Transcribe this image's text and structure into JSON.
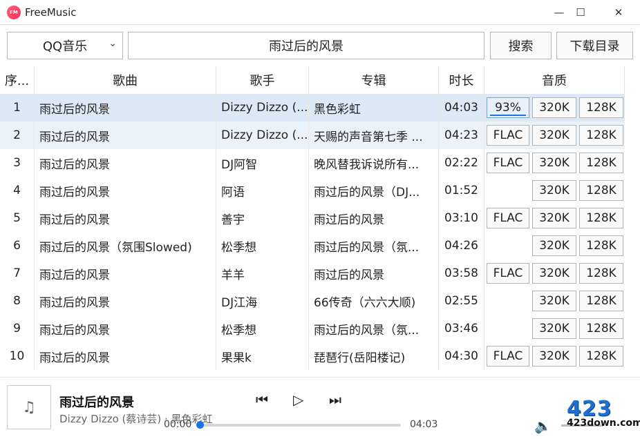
{
  "app": {
    "title": "FreeMusic",
    "logo_text": "FM"
  },
  "window": {
    "minimize": "—",
    "maximize": "☐",
    "close": "✕"
  },
  "search": {
    "source": "QQ音乐",
    "query": "雨过后的风景",
    "search_label": "搜索",
    "download_dir_label": "下载目录"
  },
  "table": {
    "headers": [
      "序...",
      "歌曲",
      "歌手",
      "专辑",
      "时长",
      "音质"
    ],
    "rows": [
      {
        "idx": "1",
        "song": "雨过后的风景",
        "artist": "Dizzy Dizzo (...",
        "album": "黑色彩虹",
        "duration": "04:03",
        "q1": "93%",
        "q2": "320K",
        "q3": "128K"
      },
      {
        "idx": "2",
        "song": "雨过后的风景",
        "artist": "Dizzy Dizzo (...",
        "album": "天赐的声音第七季 ...",
        "duration": "04:23",
        "q1": "FLAC",
        "q2": "320K",
        "q3": "128K"
      },
      {
        "idx": "3",
        "song": "雨过后的风景",
        "artist": "DJ阿智",
        "album": "晚风替我诉说所有...",
        "duration": "02:22",
        "q1": "FLAC",
        "q2": "320K",
        "q3": "128K"
      },
      {
        "idx": "4",
        "song": "雨过后的风景",
        "artist": "阿语",
        "album": "雨过后的风景（DJ...",
        "duration": "01:52",
        "q1": "",
        "q2": "320K",
        "q3": "128K"
      },
      {
        "idx": "5",
        "song": "雨过后的风景",
        "artist": "善宇",
        "album": "雨过后的风景",
        "duration": "03:10",
        "q1": "FLAC",
        "q2": "320K",
        "q3": "128K"
      },
      {
        "idx": "6",
        "song": "雨过后的风景（氛围Slowed)",
        "artist": "松季想",
        "album": "雨过后的风景（氛...",
        "duration": "04:26",
        "q1": "",
        "q2": "320K",
        "q3": "128K"
      },
      {
        "idx": "7",
        "song": "雨过后的风景",
        "artist": "羊羊",
        "album": "雨过后的风景",
        "duration": "03:58",
        "q1": "FLAC",
        "q2": "320K",
        "q3": "128K"
      },
      {
        "idx": "8",
        "song": "雨过后的风景",
        "artist": "DJ江海",
        "album": "66传奇（六六大顺)",
        "duration": "02:55",
        "q1": "",
        "q2": "320K",
        "q3": "128K"
      },
      {
        "idx": "9",
        "song": "雨过后的风景",
        "artist": "松季想",
        "album": "雨过后的风景（氛...",
        "duration": "03:46",
        "q1": "",
        "q2": "320K",
        "q3": "128K"
      },
      {
        "idx": "10",
        "song": "雨过后的风景",
        "artist": "果果k",
        "album": "琵琶行(岳阳楼记)",
        "duration": "04:30",
        "q1": "FLAC",
        "q2": "320K",
        "q3": "128K"
      }
    ]
  },
  "player": {
    "title": "雨过后的风景",
    "subtitle": "Dizzy Dizzo (蔡诗芸) · 黑色彩虹",
    "current_time": "00:00",
    "total_time": "04:03",
    "progress": 0.0,
    "cover_icon": "♫",
    "prev_icon": "⏮",
    "play_icon": "▷",
    "next_icon": "⏭",
    "volume_icon": "🔈"
  },
  "watermark": {
    "big": "423",
    "small": "423down.com"
  },
  "colors": {
    "accent": "#1a73e8",
    "selected_row": "#dde9f7",
    "logo": "#ff2d55"
  }
}
